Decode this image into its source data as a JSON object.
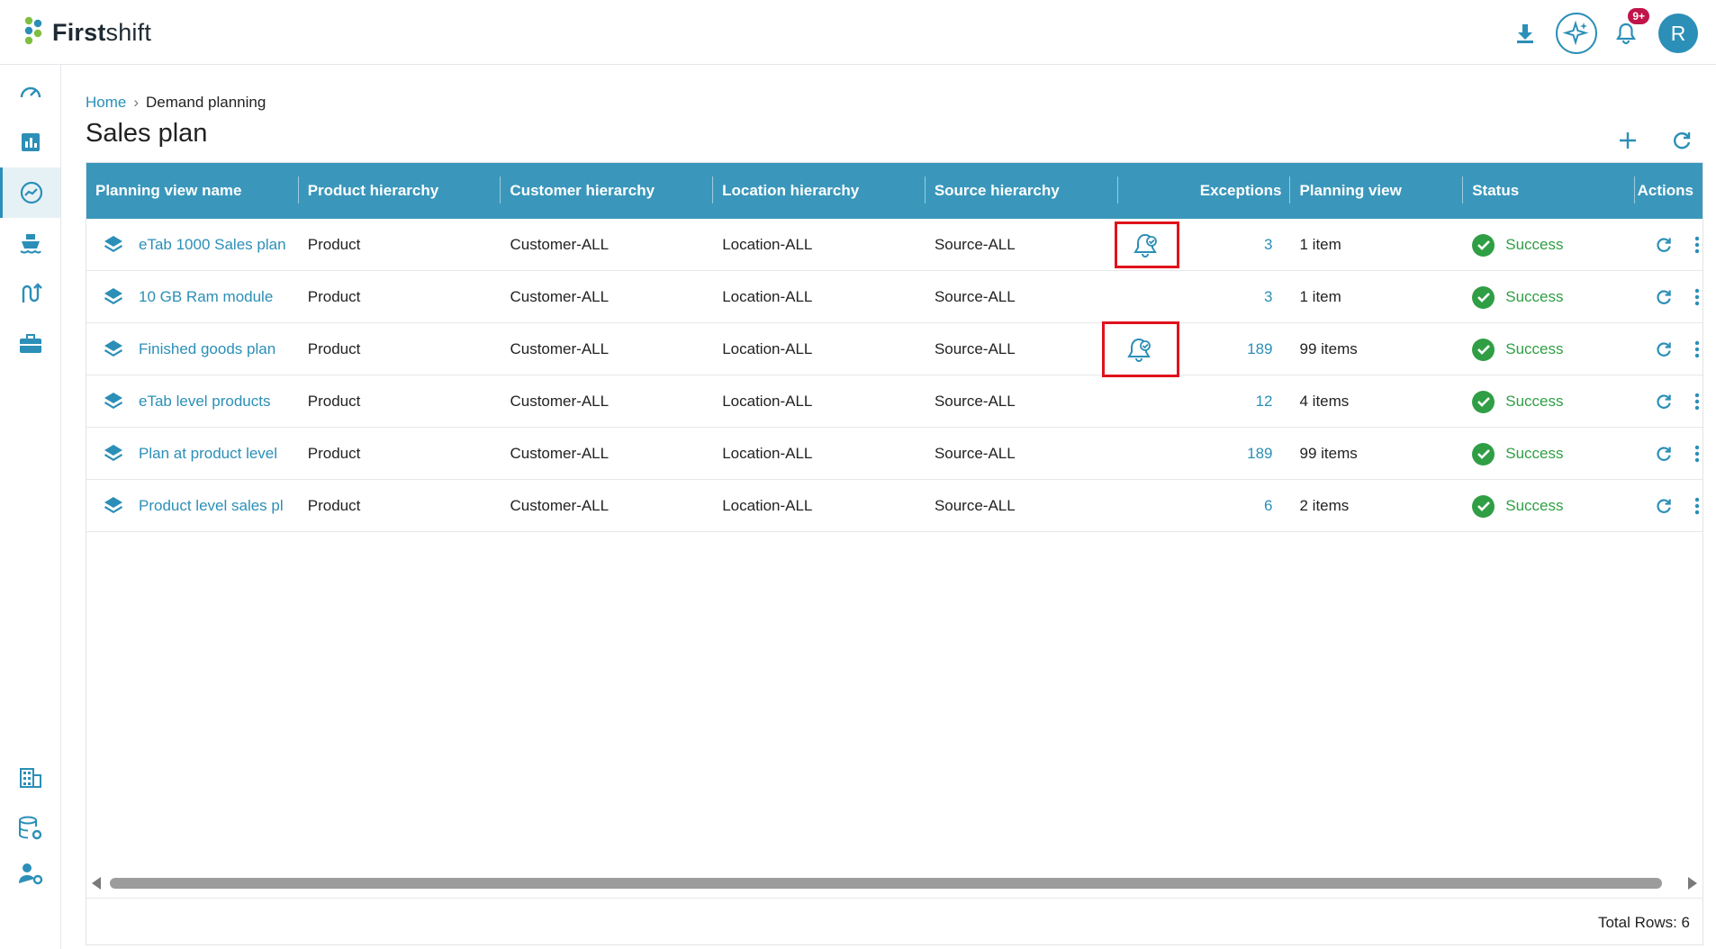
{
  "app": {
    "logo_bold": "First",
    "logo_light": "shift"
  },
  "topbar": {
    "notifications_badge": "9+",
    "avatar_initial": "R"
  },
  "sidebar": {
    "items": [
      {
        "icon": "dashboard-icon",
        "active": false
      },
      {
        "icon": "bar-chart-icon",
        "active": false
      },
      {
        "icon": "trend-icon",
        "active": true
      },
      {
        "icon": "ship-icon",
        "active": false
      },
      {
        "icon": "route-icon",
        "active": false
      },
      {
        "icon": "briefcase-icon",
        "active": false
      },
      {
        "icon": "building-icon",
        "active": false
      },
      {
        "icon": "database-settings-icon",
        "active": false
      },
      {
        "icon": "user-settings-icon",
        "active": false
      }
    ]
  },
  "breadcrumb": {
    "home": "Home",
    "separator": "›",
    "current": "Demand planning"
  },
  "page": {
    "title": "Sales plan"
  },
  "table": {
    "columns": [
      "Planning view name",
      "Product hierarchy",
      "Customer hierarchy",
      "Location hierarchy",
      "Source hierarchy",
      "",
      "Exceptions",
      "Planning view",
      "Status",
      "Actions"
    ],
    "rows": [
      {
        "name": "eTab 1000 Sales plan",
        "product": "Product",
        "customer": "Customer-ALL",
        "location": "Location-ALL",
        "source": "Source-ALL",
        "exception_icon": true,
        "exceptions": "3",
        "planning_view": "1 item",
        "status": "Success"
      },
      {
        "name": "10 GB Ram module",
        "product": "Product",
        "customer": "Customer-ALL",
        "location": "Location-ALL",
        "source": "Source-ALL",
        "exception_icon": false,
        "exceptions": "3",
        "planning_view": "1 item",
        "status": "Success"
      },
      {
        "name": "Finished goods plan",
        "product": "Product",
        "customer": "Customer-ALL",
        "location": "Location-ALL",
        "source": "Source-ALL",
        "exception_icon": true,
        "exceptions": "189",
        "planning_view": "99 items",
        "status": "Success"
      },
      {
        "name": "eTab level products",
        "product": "Product",
        "customer": "Customer-ALL",
        "location": "Location-ALL",
        "source": "Source-ALL",
        "exception_icon": false,
        "exceptions": "12",
        "planning_view": "4 items",
        "status": "Success"
      },
      {
        "name": "Plan at product level",
        "product": "Product",
        "customer": "Customer-ALL",
        "location": "Location-ALL",
        "source": "Source-ALL",
        "exception_icon": false,
        "exceptions": "189",
        "planning_view": "99 items",
        "status": "Success"
      },
      {
        "name": "Product level sales pl",
        "product": "Product",
        "customer": "Customer-ALL",
        "location": "Location-ALL",
        "source": "Source-ALL",
        "exception_icon": false,
        "exceptions": "6",
        "planning_view": "2 items",
        "status": "Success"
      }
    ]
  },
  "footer": {
    "total_rows": "Total Rows: 6"
  },
  "colors": {
    "accent": "#2b8fb7",
    "header": "#3a97bb",
    "success": "#2f9e44",
    "highlight": "#e0121b",
    "badge": "#c0144a"
  }
}
